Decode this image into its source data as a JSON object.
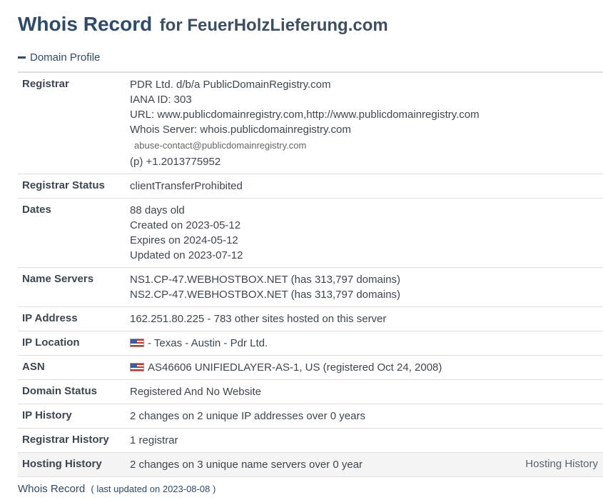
{
  "title": {
    "main": "Whois Record",
    "sub": "for FeuerHolzLieferung.com"
  },
  "section": {
    "label": "Domain Profile"
  },
  "rows": {
    "registrar": {
      "label": "Registrar",
      "name": "PDR Ltd. d/b/a PublicDomainRegistry.com",
      "iana": "IANA ID: 303",
      "url": "URL: www.publicdomainregistry.com,http://www.publicdomainregistry.com",
      "whois": "Whois Server: whois.publicdomainregistry.com",
      "email": "abuse-contact@publicdomainregistry.com",
      "phone_prefix": "(p)",
      "phone": "+1.2013775952"
    },
    "registrar_status": {
      "label": "Registrar Status",
      "value": "clientTransferProhibited"
    },
    "dates": {
      "label": "Dates",
      "age": "88 days old",
      "created": "Created on 2023-05-12",
      "expires": "Expires on 2024-05-12",
      "updated": "Updated on 2023-07-12"
    },
    "name_servers": {
      "label": "Name Servers",
      "ns1": "NS1.CP-47.WEBHOSTBOX.NET (has 313,797 domains)",
      "ns2": "NS2.CP-47.WEBHOSTBOX.NET (has 313,797 domains)"
    },
    "ip_address": {
      "label": "IP Address",
      "value": "162.251.80.225 - 783 other sites hosted on this server"
    },
    "ip_location": {
      "label": "IP Location",
      "flag_icon": "us-flag-icon",
      "value": "- Texas - Austin - Pdr Ltd."
    },
    "asn": {
      "label": "ASN",
      "flag_icon": "us-flag-icon",
      "value": "AS46606 UNIFIEDLAYER-AS-1, US (registered Oct 24, 2008)"
    },
    "domain_status": {
      "label": "Domain Status",
      "value": "Registered And No Website"
    },
    "ip_history": {
      "label": "IP History",
      "value": "2 changes on 2 unique IP addresses over 0 years"
    },
    "registrar_history": {
      "label": "Registrar History",
      "value": "1 registrar"
    },
    "hosting_history": {
      "label": "Hosting History",
      "value": "2 changes on 3 unique name servers over 0 year",
      "link": "Hosting History"
    }
  },
  "footer": {
    "link": "Whois Record",
    "updated": "( last updated on 2023-08-08 )"
  },
  "colors": {
    "heading": "#2f4a6b",
    "text": "#3e4650",
    "row_alt": "#f4f4f4",
    "border": "#dedede"
  }
}
